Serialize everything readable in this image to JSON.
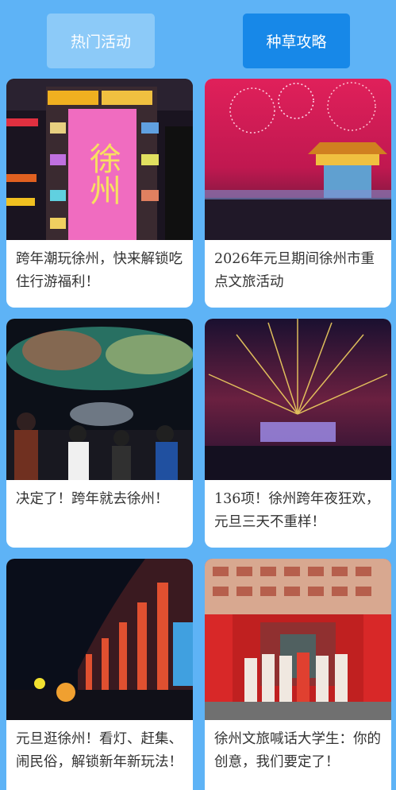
{
  "tabs": [
    {
      "label": "热门活动",
      "active": false
    },
    {
      "label": "种草攻略",
      "active": true
    }
  ],
  "colors": {
    "background": "#5eb3f6",
    "tab_inactive": "#8ccaf8",
    "tab_active": "#1788e8"
  },
  "cards": [
    {
      "title": "跨年潮玩徐州，快来解锁吃住行游福利！",
      "image": "neon-billboard-photo",
      "image_text": "徐州"
    },
    {
      "title": "2026年元旦期间徐州市重点文旅活动",
      "image": "fireworks-gate-photo"
    },
    {
      "title": "决定了！跨年就去徐州！",
      "image": "crowd-fireworks-photo"
    },
    {
      "title": "136项！徐州跨年夜狂欢，元旦三天不重样！",
      "image": "stage-fireworks-photo"
    },
    {
      "title": "元旦逛徐州！看灯、赶集、闹民俗，解锁新年新玩法！",
      "image": "night-colonnade-photo"
    },
    {
      "title": "徐州文旅喊话大学生：你的创意，我们要定了！",
      "image": "red-gate-hanfu-photo"
    }
  ]
}
